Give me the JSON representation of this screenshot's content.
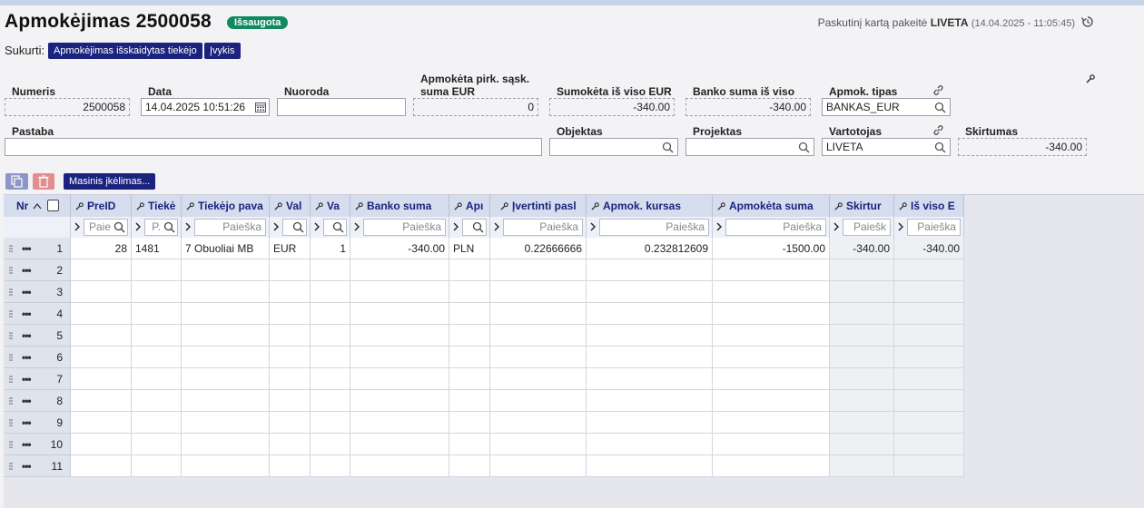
{
  "page": {
    "title": "Apmokėjimas 2500058",
    "status_badge": "Išsaugota",
    "last_modified_prefix": "Paskutinį kartą pakeitė",
    "last_modified_user": "LIVETA",
    "last_modified_time": "(14.04.2025 - 11:05:45)"
  },
  "created": {
    "label": "Sukurti:",
    "chip1": "Apmokėjimas išskaidytas tiekėjo",
    "chip2": "Įvykis"
  },
  "fields": {
    "numeris": {
      "label": "Numeris",
      "value": "2500058"
    },
    "data": {
      "label": "Data",
      "value": "14.04.2025 10:51:26"
    },
    "nuoroda": {
      "label": "Nuoroda",
      "value": ""
    },
    "apmoketa_pirk": {
      "label1": "Apmokėta pirk. sąsk.",
      "label2": "suma EUR",
      "value": "0"
    },
    "sumoketa": {
      "label": "Sumokėta iš viso EUR",
      "value": "-340.00"
    },
    "banko_suma": {
      "label": "Banko suma iš viso",
      "value": "-340.00"
    },
    "apmok_tipas": {
      "label": "Apmok. tipas",
      "value": "BANKAS_EUR"
    },
    "pastaba": {
      "label": "Pastaba",
      "value": ""
    },
    "objektas": {
      "label": "Objektas",
      "value": ""
    },
    "projektas": {
      "label": "Projektas",
      "value": ""
    },
    "vartotojas": {
      "label": "Vartotojas",
      "value": "LIVETA"
    },
    "skirtumas": {
      "label": "Skirtumas",
      "value": "-340.00"
    }
  },
  "toolbar": {
    "mass_import_label": "Masinis įkėlimas..."
  },
  "grid": {
    "columns": [
      {
        "key": "nr",
        "label": "Nr"
      },
      {
        "key": "preid",
        "label": "PreID",
        "filter": "Paie"
      },
      {
        "key": "tiek_id",
        "label": "Tiekė",
        "filter": "P."
      },
      {
        "key": "tiek_name",
        "label": "Tiekėjo pava",
        "filter": "Paieška"
      },
      {
        "key": "val",
        "label": "Val",
        "filter": ""
      },
      {
        "key": "va",
        "label": "Va",
        "filter": ""
      },
      {
        "key": "banko",
        "label": "Banko suma",
        "filter": "Paieška"
      },
      {
        "key": "apr",
        "label": "Apı",
        "filter": ""
      },
      {
        "key": "ivert",
        "label": "Įvertinti pasl",
        "filter": "Paieška"
      },
      {
        "key": "kursas",
        "label": "Apmok. kursas",
        "filter": "Paieška"
      },
      {
        "key": "apm_suma",
        "label": "Apmokėta suma",
        "filter": "Paieška"
      },
      {
        "key": "skirt",
        "label": "Skirtur",
        "filter": "Paiešk"
      },
      {
        "key": "isviso",
        "label": "Iš viso E",
        "filter": "Paieška"
      }
    ],
    "rows": [
      {
        "n": "1",
        "preid": "28",
        "tiek_id": "1481",
        "tiek_name": "7 Obuoliai MB",
        "val": "EUR",
        "va": "1",
        "banko": "-340.00",
        "apr": "PLN",
        "ivert": "0.22666666",
        "kursas": "0.232812609",
        "apm_suma": "-1500.00",
        "skirt": "-340.00",
        "isviso": "-340.00"
      },
      {
        "n": "2"
      },
      {
        "n": "3"
      },
      {
        "n": "4"
      },
      {
        "n": "5"
      },
      {
        "n": "6"
      },
      {
        "n": "7"
      },
      {
        "n": "8"
      },
      {
        "n": "9"
      },
      {
        "n": "10"
      },
      {
        "n": "11"
      }
    ]
  },
  "colors": {
    "accent": "#1a237e",
    "badge": "#0f8a5f",
    "header_bg": "#d6ddee"
  }
}
